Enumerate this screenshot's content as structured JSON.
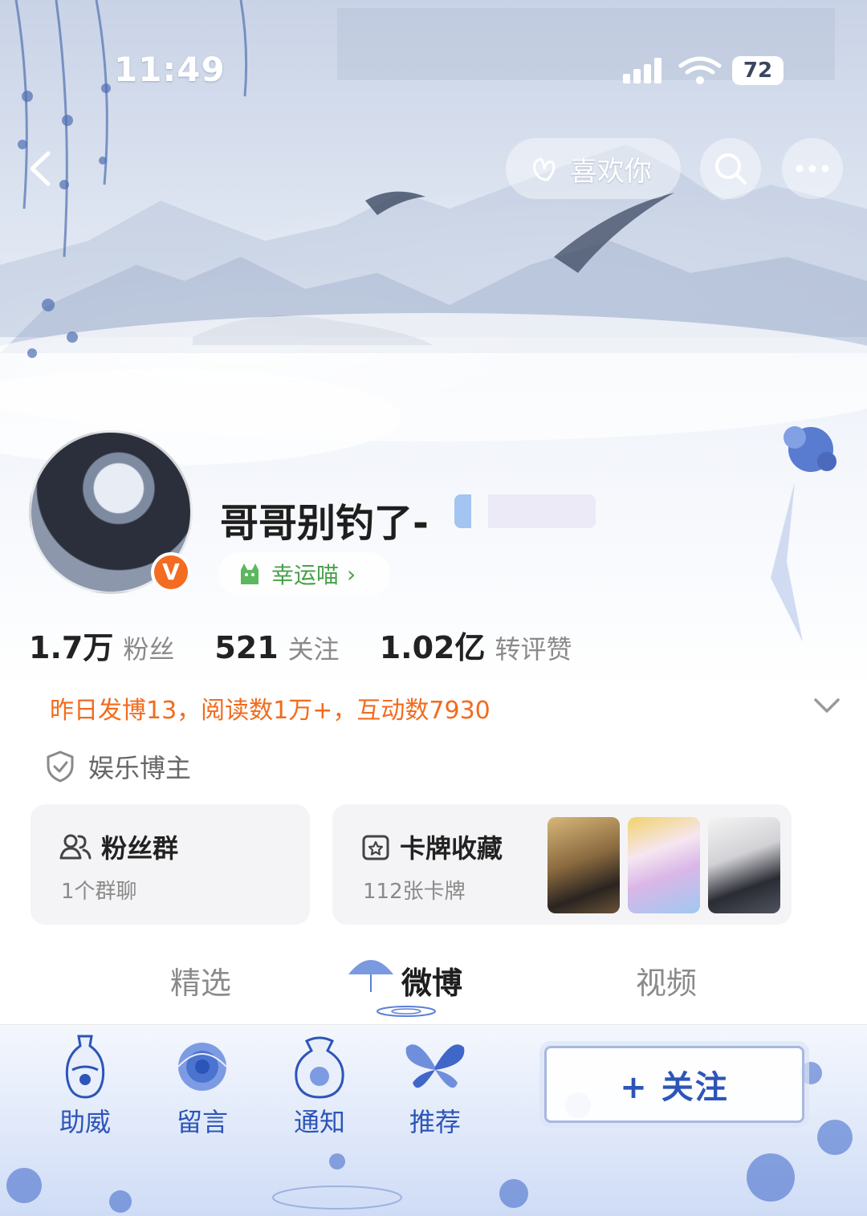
{
  "status_bar": {
    "time": "11:49",
    "battery": "72"
  },
  "top_nav": {
    "like_label": "喜欢你"
  },
  "profile": {
    "nickname": "哥哥别钓了-",
    "badge_letter": "V",
    "badge_color": "#f36c21",
    "lucky_label": "幸运喵",
    "lucky_chevron": "›",
    "stats": [
      {
        "value": "1.7万",
        "label": "粉丝"
      },
      {
        "value": "521",
        "label": "关注"
      },
      {
        "value": "1.02亿",
        "label": "转评赞"
      }
    ],
    "activity": "昨日发博13，阅读数1万+，互动数7930",
    "activity_color": "#f26b1d",
    "category": "娱乐博主"
  },
  "cards": {
    "fan_group": {
      "title": "粉丝群",
      "subtitle": "1个群聊",
      "icon": "users-icon"
    },
    "card_collection": {
      "title": "卡牌收藏",
      "subtitle": "112张卡牌",
      "icon": "card-star-icon"
    }
  },
  "tabs": [
    {
      "label": "精选",
      "active": false
    },
    {
      "label": "微博",
      "active": true
    },
    {
      "label": "视频",
      "active": false
    }
  ],
  "bottom_bar": {
    "items": [
      {
        "label": "助威",
        "icon": "vase-icon"
      },
      {
        "label": "留言",
        "icon": "peony-icon"
      },
      {
        "label": "通知",
        "icon": "pouch-icon"
      },
      {
        "label": "推荐",
        "icon": "butterfly-icon"
      }
    ],
    "follow_label": "+ 关注",
    "accent_color": "#2d55b8"
  }
}
